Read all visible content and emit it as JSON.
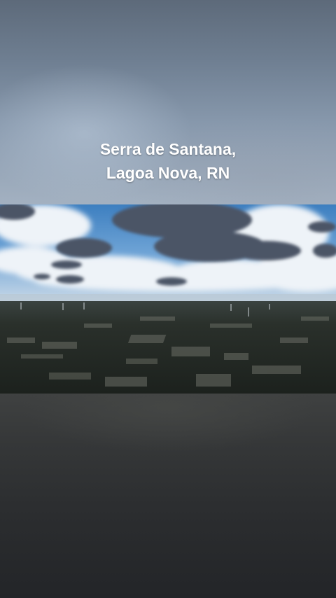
{
  "overlay": {
    "title_line1": "Serra de Santana,",
    "title_line2": "Lagoa Nova, RN"
  },
  "colors": {
    "sky_blue": "#4f8fc9",
    "cloud_dark": "#4a5568",
    "ground_dark": "#1f2420",
    "text": "#ffffff"
  }
}
